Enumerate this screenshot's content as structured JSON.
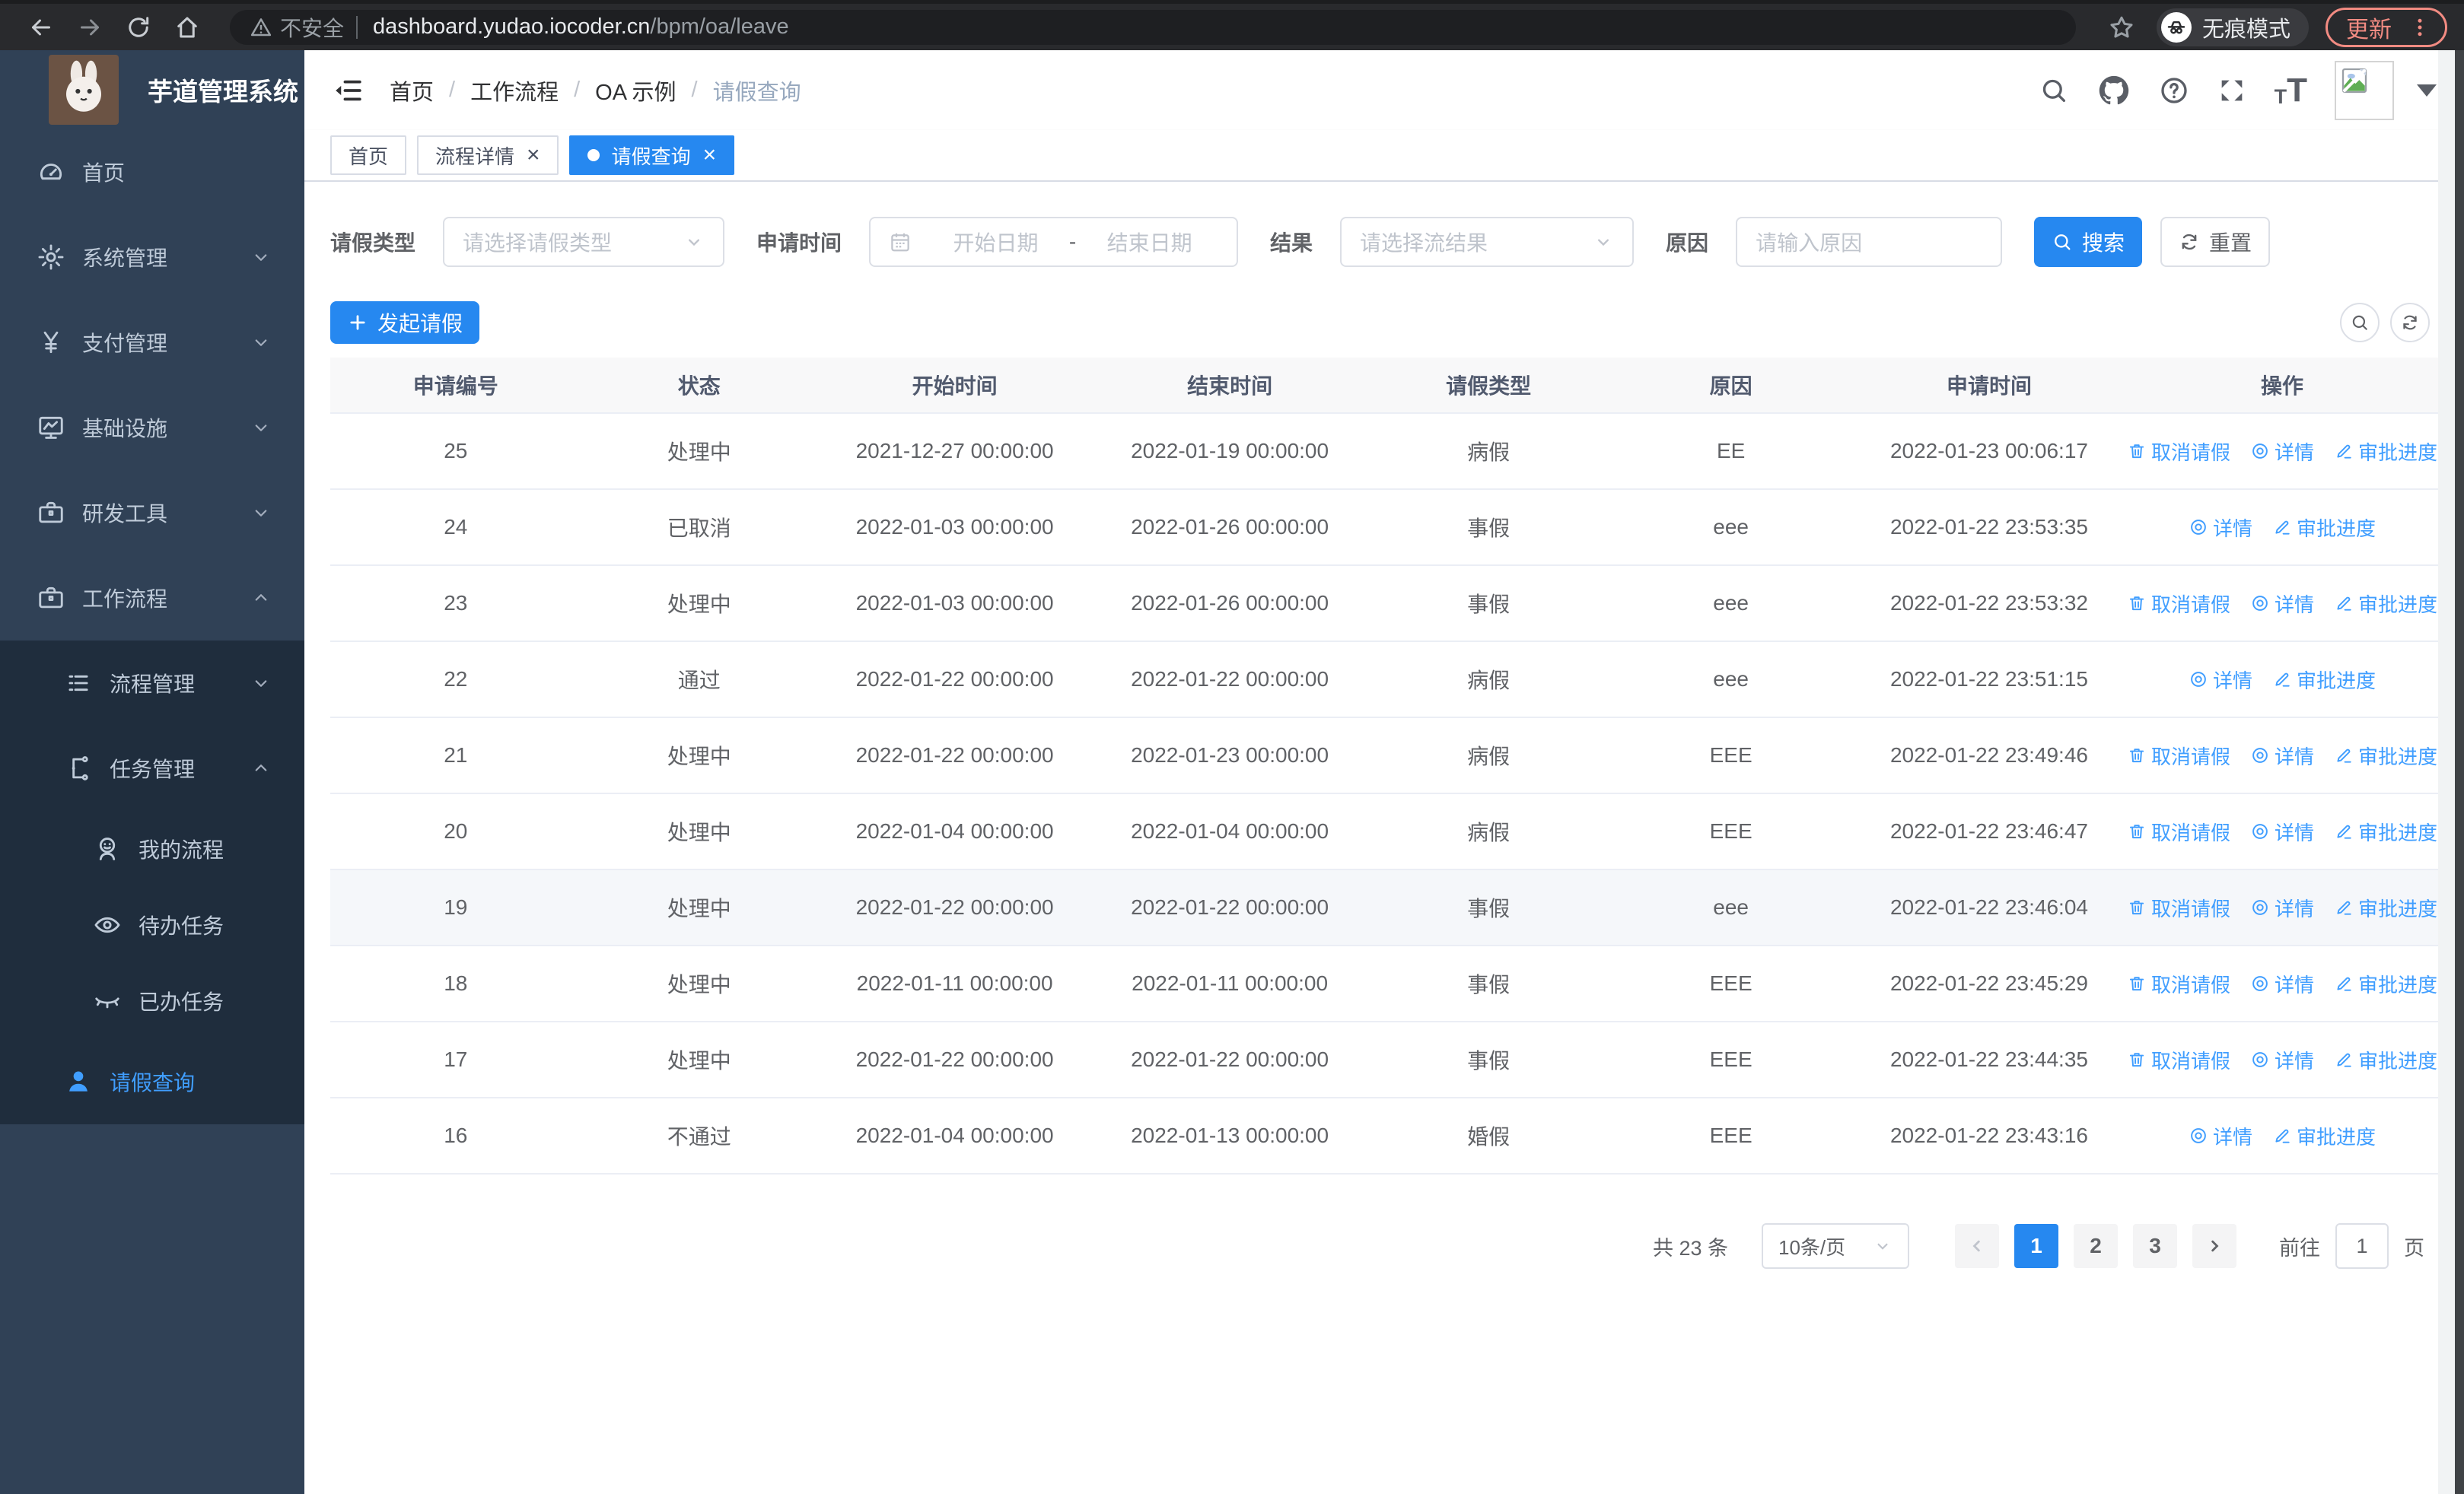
{
  "browser": {
    "security_label": "不安全",
    "url_host": "dashboard.yudao.iocoder.cn",
    "url_path": "/bpm/oa/leave",
    "incognito_label": "无痕模式",
    "update_label": "更新"
  },
  "sidebar": {
    "title": "芋道管理系统",
    "items": [
      {
        "key": "home",
        "label": "首页",
        "icon": "gauge",
        "level": 1,
        "chevron": null,
        "dark": false,
        "active": false
      },
      {
        "key": "system",
        "label": "系统管理",
        "icon": "gear",
        "level": 1,
        "chevron": "down",
        "dark": false,
        "active": false
      },
      {
        "key": "payment",
        "label": "支付管理",
        "icon": "yen",
        "level": 1,
        "chevron": "down",
        "dark": false,
        "active": false
      },
      {
        "key": "infra",
        "label": "基础设施",
        "icon": "monitor",
        "level": 1,
        "chevron": "down",
        "dark": false,
        "active": false
      },
      {
        "key": "devtools",
        "label": "研发工具",
        "icon": "toolbox",
        "level": 1,
        "chevron": "down",
        "dark": false,
        "active": false
      },
      {
        "key": "workflow",
        "label": "工作流程",
        "icon": "toolbox",
        "level": 1,
        "chevron": "up",
        "dark": false,
        "active": false
      },
      {
        "key": "process-mgmt",
        "label": "流程管理",
        "icon": "list",
        "level": 2,
        "chevron": "down",
        "dark": true,
        "active": false
      },
      {
        "key": "task-mgmt",
        "label": "任务管理",
        "icon": "flow",
        "level": 2,
        "chevron": "up",
        "dark": true,
        "active": false
      },
      {
        "key": "my-process",
        "label": "我的流程",
        "icon": "face",
        "level": 3,
        "chevron": null,
        "dark": true,
        "active": false
      },
      {
        "key": "todo-task",
        "label": "待办任务",
        "icon": "eye",
        "level": 3,
        "chevron": null,
        "dark": true,
        "active": false
      },
      {
        "key": "done-task",
        "label": "已办任务",
        "icon": "eye-closed",
        "level": 3,
        "chevron": null,
        "dark": true,
        "active": false
      },
      {
        "key": "leave-query",
        "label": "请假查询",
        "icon": "user-filled",
        "level": 2,
        "chevron": null,
        "dark": true,
        "active": true
      }
    ]
  },
  "header": {
    "breadcrumb": [
      "首页",
      "工作流程",
      "OA 示例",
      "请假查询"
    ]
  },
  "tabs": [
    {
      "key": "home",
      "label": "首页",
      "closable": false,
      "active": false
    },
    {
      "key": "process-detail",
      "label": "流程详情",
      "closable": true,
      "active": false
    },
    {
      "key": "leave-query",
      "label": "请假查询",
      "closable": true,
      "active": true
    }
  ],
  "filters": {
    "leave_type_label": "请假类型",
    "leave_type_placeholder": "请选择请假类型",
    "apply_time_label": "申请时间",
    "start_date_placeholder": "开始日期",
    "date_separator": "-",
    "end_date_placeholder": "结束日期",
    "result_label": "结果",
    "result_placeholder": "请选择流结果",
    "reason_label": "原因",
    "reason_placeholder": "请输入原因",
    "search_label": "搜索",
    "reset_label": "重置"
  },
  "toolbar": {
    "create_label": "发起请假"
  },
  "table": {
    "columns": [
      "申请编号",
      "状态",
      "开始时间",
      "结束时间",
      "请假类型",
      "原因",
      "申请时间",
      "操作"
    ],
    "action_labels": {
      "cancel": "取消请假",
      "detail": "详情",
      "progress": "审批进度"
    },
    "rows": [
      {
        "id": "25",
        "status": "处理中",
        "start": "2021-12-27 00:00:00",
        "end": "2022-01-19 00:00:00",
        "type": "病假",
        "reason": "EE",
        "applied": "2022-01-23 00:06:17",
        "can_cancel": true,
        "highlight": false
      },
      {
        "id": "24",
        "status": "已取消",
        "start": "2022-01-03 00:00:00",
        "end": "2022-01-26 00:00:00",
        "type": "事假",
        "reason": "eee",
        "applied": "2022-01-22 23:53:35",
        "can_cancel": false,
        "highlight": false
      },
      {
        "id": "23",
        "status": "处理中",
        "start": "2022-01-03 00:00:00",
        "end": "2022-01-26 00:00:00",
        "type": "事假",
        "reason": "eee",
        "applied": "2022-01-22 23:53:32",
        "can_cancel": true,
        "highlight": false
      },
      {
        "id": "22",
        "status": "通过",
        "start": "2022-01-22 00:00:00",
        "end": "2022-01-22 00:00:00",
        "type": "病假",
        "reason": "eee",
        "applied": "2022-01-22 23:51:15",
        "can_cancel": false,
        "highlight": false
      },
      {
        "id": "21",
        "status": "处理中",
        "start": "2022-01-22 00:00:00",
        "end": "2022-01-23 00:00:00",
        "type": "病假",
        "reason": "EEE",
        "applied": "2022-01-22 23:49:46",
        "can_cancel": true,
        "highlight": false
      },
      {
        "id": "20",
        "status": "处理中",
        "start": "2022-01-04 00:00:00",
        "end": "2022-01-04 00:00:00",
        "type": "病假",
        "reason": "EEE",
        "applied": "2022-01-22 23:46:47",
        "can_cancel": true,
        "highlight": false
      },
      {
        "id": "19",
        "status": "处理中",
        "start": "2022-01-22 00:00:00",
        "end": "2022-01-22 00:00:00",
        "type": "事假",
        "reason": "eee",
        "applied": "2022-01-22 23:46:04",
        "can_cancel": true,
        "highlight": true
      },
      {
        "id": "18",
        "status": "处理中",
        "start": "2022-01-11 00:00:00",
        "end": "2022-01-11 00:00:00",
        "type": "事假",
        "reason": "EEE",
        "applied": "2022-01-22 23:45:29",
        "can_cancel": true,
        "highlight": false
      },
      {
        "id": "17",
        "status": "处理中",
        "start": "2022-01-22 00:00:00",
        "end": "2022-01-22 00:00:00",
        "type": "事假",
        "reason": "EEE",
        "applied": "2022-01-22 23:44:35",
        "can_cancel": true,
        "highlight": false
      },
      {
        "id": "16",
        "status": "不通过",
        "start": "2022-01-04 00:00:00",
        "end": "2022-01-13 00:00:00",
        "type": "婚假",
        "reason": "EEE",
        "applied": "2022-01-22 23:43:16",
        "can_cancel": false,
        "highlight": false
      }
    ]
  },
  "pagination": {
    "total_label": "共 23 条",
    "page_size": "10条/页",
    "pages": [
      "1",
      "2",
      "3"
    ],
    "active_page": "1",
    "goto_label": "前往",
    "goto_value": "1",
    "page_unit": "页"
  },
  "colors": {
    "primary": "#2688f0",
    "link": "#409eff",
    "sidebar_bg": "#304156",
    "submenu_bg": "#1f2d3d"
  }
}
